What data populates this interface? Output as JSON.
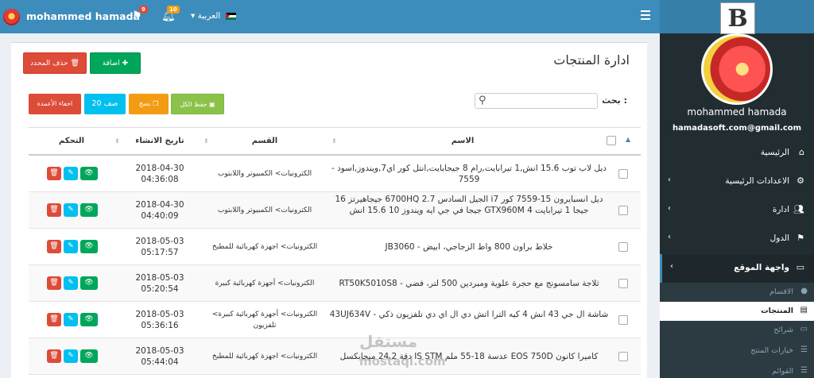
{
  "header": {
    "user_name": "mohammed hamada",
    "flag_badge": "9",
    "bell_badge": "10",
    "language": "العربية"
  },
  "sidebar": {
    "logo": "B",
    "user_name": "mohammed hamada",
    "email": "hamadasoft.com@gmail.com",
    "items": [
      {
        "label": "الرئيسية",
        "icon": "home-icon"
      },
      {
        "label": "الاعدادات الرئيسية",
        "icon": "gear-icon"
      },
      {
        "label": "ادارة",
        "icon": "users-icon"
      },
      {
        "label": "الدول",
        "icon": "flag-icon"
      },
      {
        "label": "واجهة الموقع",
        "icon": "monitor-icon"
      }
    ],
    "subitems": [
      {
        "label": "الاقسام",
        "icon": "tag-icon"
      },
      {
        "label": "المنتجات",
        "icon": "file-icon"
      },
      {
        "label": "شرائح",
        "icon": "desktop-icon"
      },
      {
        "label": "خيارات المنتج",
        "icon": "list-icon"
      },
      {
        "label": "القوائم",
        "icon": "list-icon"
      }
    ]
  },
  "main": {
    "title": "ادارة المنتجات",
    "delete_selected": "حذف المحدد",
    "add": "اضافة",
    "hide_columns": "اخفاء الأعمدة",
    "rows": "20 صف",
    "copy": "نسخ",
    "save_all": "حفظ الكل",
    "search_label": "بحث :",
    "columns": {
      "name": "الاسم",
      "category": "القسم",
      "created": "تاريخ الانشاء",
      "control": "التحكم"
    },
    "rows_data": [
      {
        "name": "ديل لاب توب 15.6 انش,1 تيرابايت,رام 8 جيجابايت,انتل كور اي7,ويندوز,اسود - 7559",
        "category": "الكترونيات> الكمبيوتر واللابتوب",
        "date": "2018-04-30",
        "time": "04:36:08"
      },
      {
        "name": "ديل انسبايرون 15-7559 كور i7 الجيل السادس 2.7 6700HQ جيجاهيرتز 16 جيجا 1 تيرابايت 4 GTX960M جيجا في جي ايه ويندوز 10 15.6 انش",
        "category": "الكترونيات> الكمبيوتر واللابتوب",
        "date": "2018-04-30",
        "time": "04:40:09"
      },
      {
        "name": "خلاط براون 800 واط الزجاجي، ابيض - JB3060",
        "category": "الكترونيات> اجهزة كهربائية للمطبخ",
        "date": "2018-05-03",
        "time": "05:17:57"
      },
      {
        "name": "ثلاجة سامسونج مع حجرة علوية ومبردين 500 لتر، فضي - RT50K5010S8",
        "category": "الكترونيات> أجهزة كهربائية كبيرة",
        "date": "2018-05-03",
        "time": "05:20:54"
      },
      {
        "name": "شاشة ال جي 43 انش 4 كيه الترا اتش دي ال اي دي تلفزيون ذكي - 43UJ634V",
        "category": "الكترونيات> أجهزة كهربائية كبيرة> تلفزيون",
        "date": "2018-05-03",
        "time": "05:36:16"
      },
      {
        "name": "كاميرا كانون EOS 750D عدسة 18-55 ملم IS STM دقة 24.2 ميجابكسل",
        "category": "الكترونيات> اجهزة كهربائية للمطبخ",
        "date": "2018-05-03",
        "time": "05:44:04"
      }
    ]
  },
  "watermark": {
    "arabic": "مستقل",
    "latin": "mostaql.com"
  }
}
